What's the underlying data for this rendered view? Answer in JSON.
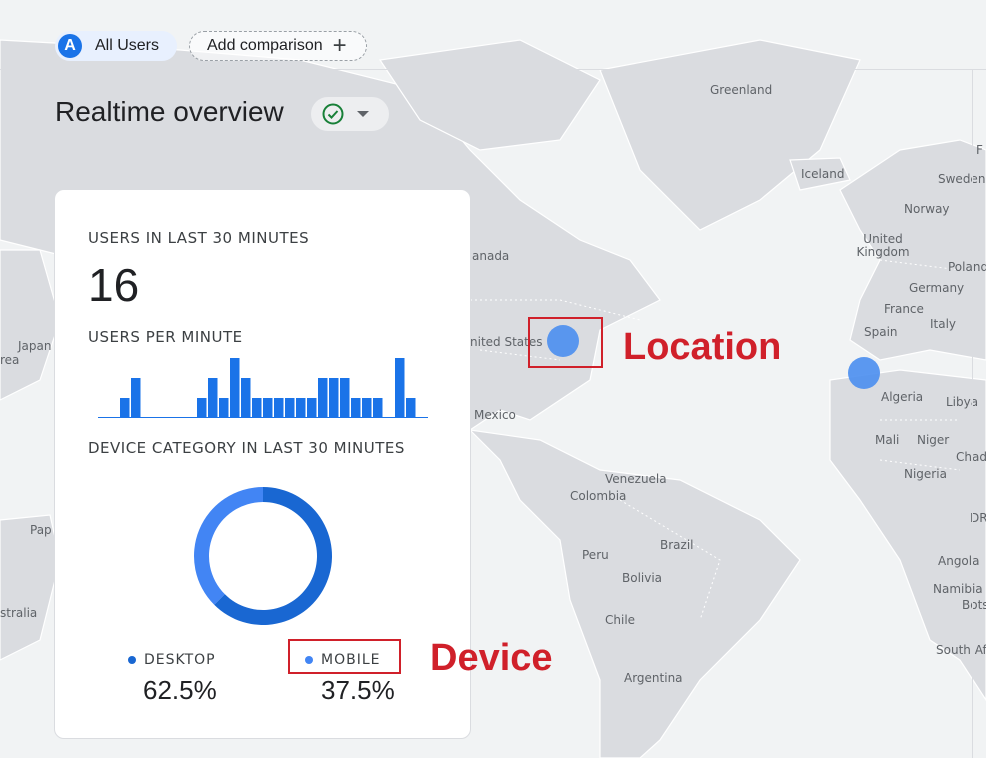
{
  "header": {
    "user_chip": {
      "avatar_letter": "A",
      "label": "All Users"
    },
    "add_comparison": {
      "label": "Add comparison"
    },
    "title": "Realtime overview"
  },
  "card": {
    "users_heading": "USERS IN LAST 30 MINUTES",
    "users_count": "16",
    "per_minute_heading": "USERS PER MINUTE",
    "device_heading": "DEVICE CATEGORY IN LAST 30 MINUTES",
    "devices": [
      {
        "label": "DESKTOP",
        "percent": "62.5%",
        "color": "#1967d2"
      },
      {
        "label": "MOBILE",
        "percent": "37.5%",
        "color": "#4285f4"
      }
    ]
  },
  "map_labels": {
    "greenland": "Greenland",
    "iceland": "Iceland",
    "sweden": "Sweden",
    "norway": "Norway",
    "uk": "United Kingdom",
    "poland": "Poland",
    "germany": "Germany",
    "france": "France",
    "italy": "Italy",
    "spain": "Spain",
    "canada": "anada",
    "us": "nited States",
    "mexico": "Mexico",
    "japan": "Japan",
    "korea": "rea",
    "papua": "Pap",
    "australia": "stralia",
    "algeria": "Algeria",
    "libya": "Libya",
    "mali": "Mali",
    "niger": "Niger",
    "chad": "Chad",
    "nigeria": "Nigeria",
    "drc": "DR",
    "venezuela": "Venezuela",
    "colombia": "Colombia",
    "peru": "Peru",
    "brazil": "Brazil",
    "bolivia": "Bolivia",
    "chile": "Chile",
    "argentina": "Argentina",
    "angola": "Angola",
    "namibia": "Namibia",
    "botswana": "Bots",
    "south_africa": "South Af",
    "edge_f": "F"
  },
  "annotations": {
    "location": "Location",
    "device": "Device"
  },
  "chart_data": {
    "type": "bar",
    "title": "USERS PER MINUTE",
    "values": [
      0,
      0,
      1,
      2,
      0,
      0,
      0,
      0,
      0,
      1,
      2,
      1,
      3,
      2,
      1,
      1,
      1,
      1,
      1,
      1,
      2,
      2,
      2,
      1,
      1,
      1,
      0,
      3,
      1,
      0
    ],
    "ylim": [
      0,
      3
    ],
    "grid": false
  },
  "donut_data": {
    "type": "pie",
    "categories": [
      "DESKTOP",
      "MOBILE"
    ],
    "values": [
      62.5,
      37.5
    ]
  }
}
